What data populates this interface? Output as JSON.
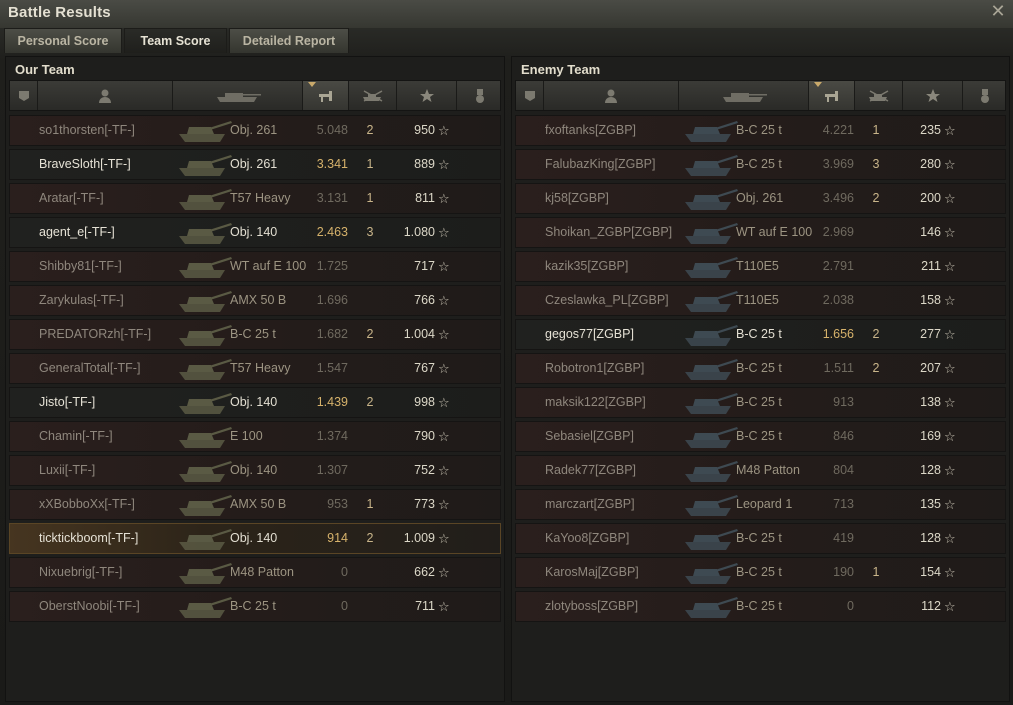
{
  "window": {
    "title": "Battle Results",
    "close_glyph": "✕"
  },
  "tabs": [
    {
      "label": "Personal Score",
      "active": false
    },
    {
      "label": "Team Score",
      "active": true
    },
    {
      "label": "Detailed Report",
      "active": false
    }
  ],
  "header_icons": [
    "squad-icon",
    "player-icon",
    "tank-icon",
    "damage-icon",
    "kills-icon",
    "xp-icon",
    "medal-icon"
  ],
  "star_glyph": "☆",
  "our_team": {
    "title": "Our Team",
    "players": [
      {
        "name": "so1thorsten[-TF-]",
        "tank": "Obj. 261",
        "damage": "5.048",
        "kills": "2",
        "xp": "950",
        "alive": false,
        "self": false
      },
      {
        "name": "BraveSloth[-TF-]",
        "tank": "Obj. 261",
        "damage": "3.341",
        "kills": "1",
        "xp": "889",
        "alive": true,
        "self": false
      },
      {
        "name": "Aratar[-TF-]",
        "tank": "T57 Heavy",
        "damage": "3.131",
        "kills": "1",
        "xp": "811",
        "alive": false,
        "self": false
      },
      {
        "name": "agent_e[-TF-]",
        "tank": "Obj. 140",
        "damage": "2.463",
        "kills": "3",
        "xp": "1.080",
        "alive": true,
        "self": false
      },
      {
        "name": "Shibby81[-TF-]",
        "tank": "WT auf E 100",
        "damage": "1.725",
        "kills": "",
        "xp": "717",
        "alive": false,
        "self": false
      },
      {
        "name": "Zarykulas[-TF-]",
        "tank": "AMX 50 B",
        "damage": "1.696",
        "kills": "",
        "xp": "766",
        "alive": false,
        "self": false
      },
      {
        "name": "PREDATORzh[-TF-]",
        "tank": "B-C 25 t",
        "damage": "1.682",
        "kills": "2",
        "xp": "1.004",
        "alive": false,
        "self": false
      },
      {
        "name": "GeneralTotal[-TF-]",
        "tank": "T57 Heavy",
        "damage": "1.547",
        "kills": "",
        "xp": "767",
        "alive": false,
        "self": false
      },
      {
        "name": "Jisto[-TF-]",
        "tank": "Obj. 140",
        "damage": "1.439",
        "kills": "2",
        "xp": "998",
        "alive": true,
        "self": false
      },
      {
        "name": "Chamin[-TF-]",
        "tank": "E 100",
        "damage": "1.374",
        "kills": "",
        "xp": "790",
        "alive": false,
        "self": false
      },
      {
        "name": "Luxii[-TF-]",
        "tank": "Obj. 140",
        "damage": "1.307",
        "kills": "",
        "xp": "752",
        "alive": false,
        "self": false
      },
      {
        "name": "xXBobboXx[-TF-]",
        "tank": "AMX 50 B",
        "damage": "953",
        "kills": "1",
        "xp": "773",
        "alive": false,
        "self": false
      },
      {
        "name": "ticktickboom[-TF-]",
        "tank": "Obj. 140",
        "damage": "914",
        "kills": "2",
        "xp": "1.009",
        "alive": true,
        "self": true
      },
      {
        "name": "Nixuebrig[-TF-]",
        "tank": "M48 Patton",
        "damage": "0",
        "kills": "",
        "xp": "662",
        "alive": false,
        "self": false
      },
      {
        "name": "OberstNoobi[-TF-]",
        "tank": "B-C 25 t",
        "damage": "0",
        "kills": "",
        "xp": "711",
        "alive": false,
        "self": false
      }
    ]
  },
  "enemy_team": {
    "title": "Enemy Team",
    "players": [
      {
        "name": "fxoftanks[ZGBP]",
        "tank": "B-C 25 t",
        "damage": "4.221",
        "kills": "1",
        "xp": "235",
        "alive": false,
        "self": false
      },
      {
        "name": "FalubazKing[ZGBP]",
        "tank": "B-C 25 t",
        "damage": "3.969",
        "kills": "3",
        "xp": "280",
        "alive": false,
        "self": false
      },
      {
        "name": "kj58[ZGBP]",
        "tank": "Obj. 261",
        "damage": "3.496",
        "kills": "2",
        "xp": "200",
        "alive": false,
        "self": false
      },
      {
        "name": "Shoikan_ZGBP[ZGBP]",
        "tank": "WT auf E 100",
        "damage": "2.969",
        "kills": "",
        "xp": "146",
        "alive": false,
        "self": false
      },
      {
        "name": "kazik35[ZGBP]",
        "tank": "T110E5",
        "damage": "2.791",
        "kills": "",
        "xp": "211",
        "alive": false,
        "self": false
      },
      {
        "name": "Czeslawka_PL[ZGBP]",
        "tank": "T110E5",
        "damage": "2.038",
        "kills": "",
        "xp": "158",
        "alive": false,
        "self": false
      },
      {
        "name": "gegos77[ZGBP]",
        "tank": "B-C 25 t",
        "damage": "1.656",
        "kills": "2",
        "xp": "277",
        "alive": true,
        "self": false
      },
      {
        "name": "Robotron1[ZGBP]",
        "tank": "B-C 25 t",
        "damage": "1.511",
        "kills": "2",
        "xp": "207",
        "alive": false,
        "self": false
      },
      {
        "name": "maksik122[ZGBP]",
        "tank": "B-C 25 t",
        "damage": "913",
        "kills": "",
        "xp": "138",
        "alive": false,
        "self": false
      },
      {
        "name": "Sebasiel[ZGBP]",
        "tank": "B-C 25 t",
        "damage": "846",
        "kills": "",
        "xp": "169",
        "alive": false,
        "self": false
      },
      {
        "name": "Radek77[ZGBP]",
        "tank": "M48 Patton",
        "damage": "804",
        "kills": "",
        "xp": "128",
        "alive": false,
        "self": false
      },
      {
        "name": "marczart[ZGBP]",
        "tank": "Leopard 1",
        "damage": "713",
        "kills": "",
        "xp": "135",
        "alive": false,
        "self": false
      },
      {
        "name": "KaYoo8[ZGBP]",
        "tank": "B-C 25 t",
        "damage": "419",
        "kills": "",
        "xp": "128",
        "alive": false,
        "self": false
      },
      {
        "name": "KarosMaj[ZGBP]",
        "tank": "B-C 25 t",
        "damage": "190",
        "kills": "1",
        "xp": "154",
        "alive": false,
        "self": false
      },
      {
        "name": "zlotyboss[ZGBP]",
        "tank": "B-C 25 t",
        "damage": "0",
        "kills": "",
        "xp": "112",
        "alive": false,
        "self": false
      }
    ]
  }
}
